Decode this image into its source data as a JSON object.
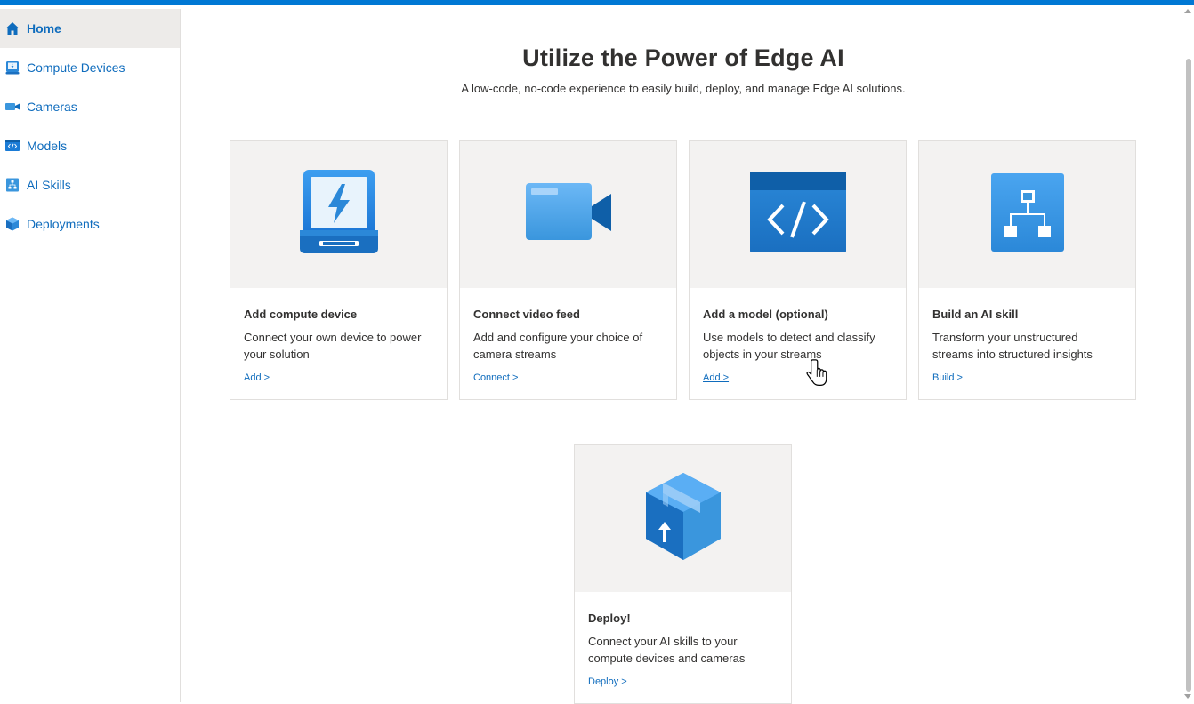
{
  "nav": {
    "items": [
      {
        "label": "Home",
        "icon": "home-icon",
        "active": true
      },
      {
        "label": "Compute Devices",
        "icon": "compute-device-icon"
      },
      {
        "label": "Cameras",
        "icon": "camera-icon"
      },
      {
        "label": "Models",
        "icon": "model-icon"
      },
      {
        "label": "AI Skills",
        "icon": "ai-skill-icon"
      },
      {
        "label": "Deployments",
        "icon": "deployment-icon"
      }
    ]
  },
  "hero": {
    "title": "Utilize the Power of Edge AI",
    "subtitle": "A low-code, no-code experience to easily build, deploy, and manage Edge AI solutions."
  },
  "cards": [
    {
      "title": "Add compute device",
      "desc": "Connect your own device to power your solution",
      "link": "Add >",
      "icon": "compute-device-icon"
    },
    {
      "title": "Connect video feed",
      "desc": "Add and configure your choice of camera streams",
      "link": "Connect >",
      "icon": "video-camera-icon"
    },
    {
      "title": "Add a model (optional)",
      "desc": "Use models to detect and classify objects in your streams",
      "link": "Add >",
      "icon": "code-model-icon"
    },
    {
      "title": "Build an AI skill",
      "desc": "Transform your unstructured streams into structured insights",
      "link": "Build >",
      "icon": "hierarchy-icon"
    },
    {
      "title": "Deploy!",
      "desc": "Connect your AI skills to your compute devices and cameras",
      "link": "Deploy >",
      "icon": "package-icon"
    }
  ],
  "colors": {
    "accent": "#0078d4",
    "link": "#0f6cbd",
    "card_image_bg": "#f3f2f1"
  }
}
